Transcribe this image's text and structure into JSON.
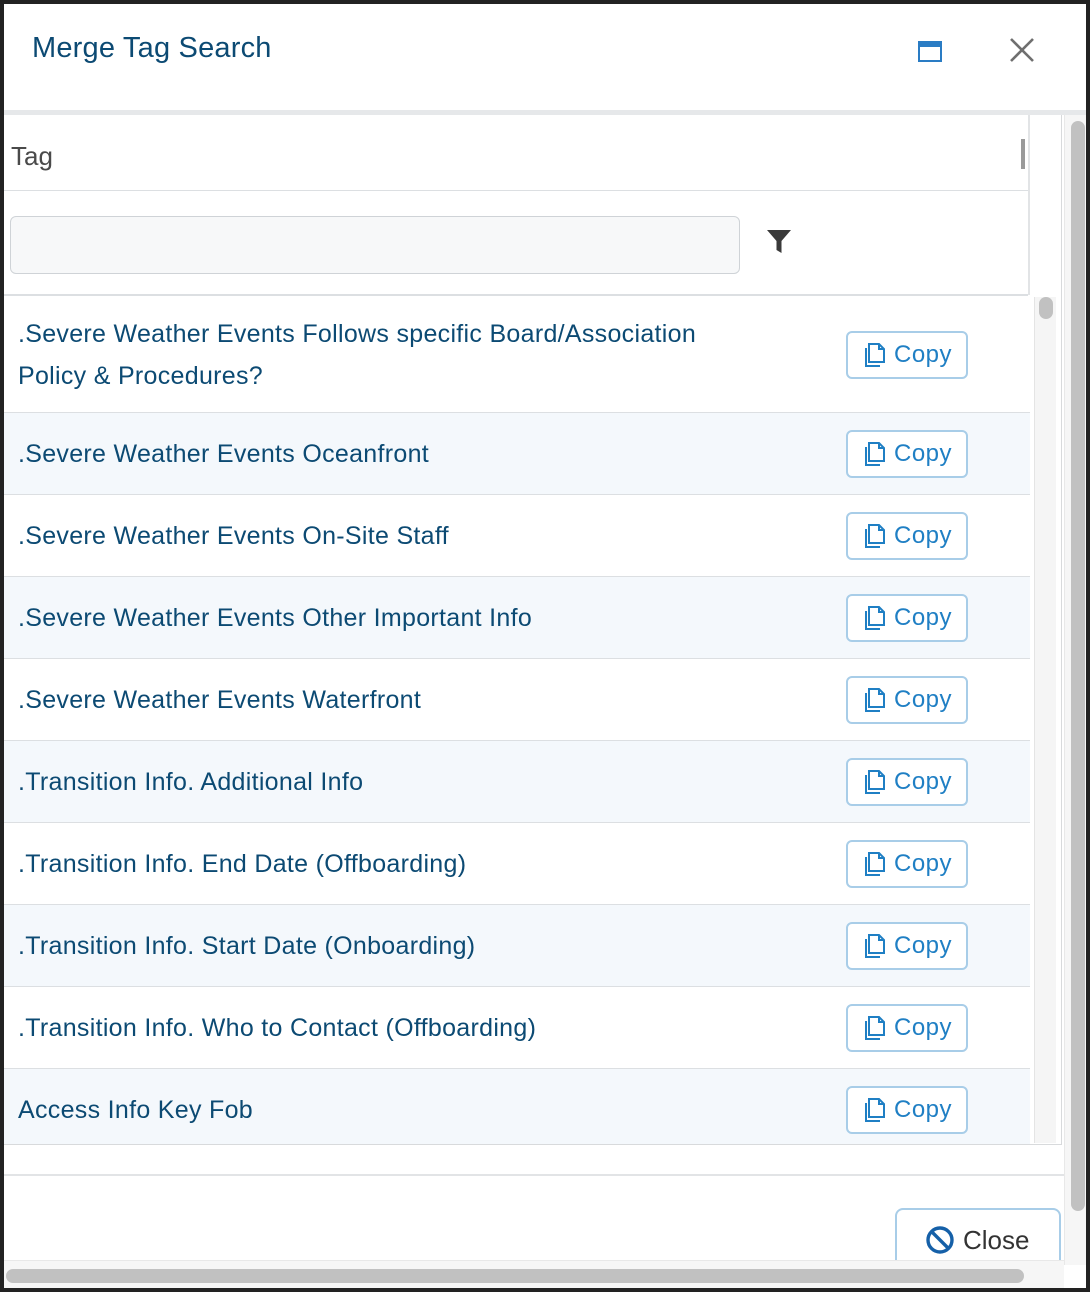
{
  "dialog": {
    "title": "Merge Tag Search"
  },
  "grid": {
    "column_header": "Tag",
    "filter": {
      "value": "",
      "placeholder": ""
    },
    "rows": [
      {
        "label": ".Severe Weather Events Follows specific Board/Association Policy & Procedures?",
        "copy_label": "Copy"
      },
      {
        "label": ".Severe Weather Events Oceanfront",
        "copy_label": "Copy"
      },
      {
        "label": ".Severe Weather Events On-Site Staff",
        "copy_label": "Copy"
      },
      {
        "label": ".Severe Weather Events Other Important Info",
        "copy_label": "Copy"
      },
      {
        "label": ".Severe Weather Events Waterfront",
        "copy_label": "Copy"
      },
      {
        "label": ".Transition Info. Additional Info",
        "copy_label": "Copy"
      },
      {
        "label": ".Transition Info. End Date (Offboarding)",
        "copy_label": "Copy"
      },
      {
        "label": ".Transition Info. Start Date (Onboarding)",
        "copy_label": "Copy"
      },
      {
        "label": ".Transition Info. Who to Contact (Offboarding)",
        "copy_label": "Copy"
      },
      {
        "label": "Access Info Key Fob",
        "copy_label": "Copy"
      }
    ]
  },
  "footer": {
    "close_label": "Close"
  },
  "icons": {
    "maximize": "maximize-icon",
    "close": "close-icon",
    "filter": "filter-icon",
    "copy": "copy-icon",
    "cancel": "cancel-icon"
  },
  "colors": {
    "title": "#0c4a73",
    "link_text": "#0c4a73",
    "accent": "#1f7fc4",
    "alt_row": "#f4f8fc",
    "button_border": "#a8cde8",
    "cancel_icon": "#1560a8"
  }
}
